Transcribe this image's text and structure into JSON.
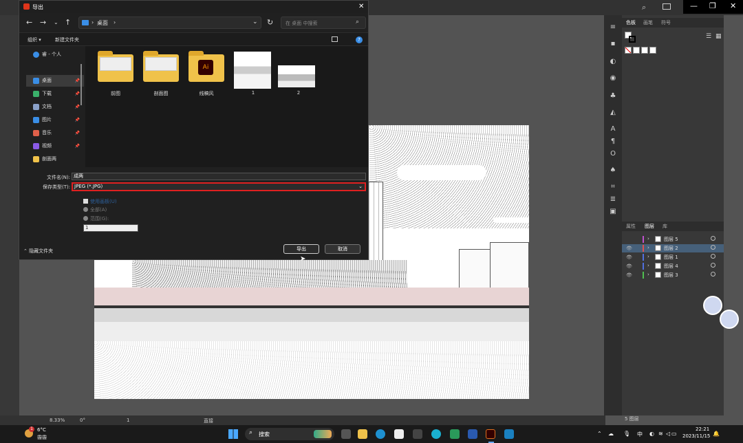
{
  "dialog": {
    "title": "导出",
    "close": "✕",
    "address": {
      "crumb": "桌面",
      "sep": "›"
    },
    "search_placeholder": "在 桌面 中搜索",
    "toolbar": {
      "organize": "组织 ▾",
      "new_folder": "新建文件夹"
    },
    "sidebar": [
      {
        "label": "睿 - 个人",
        "icon": "cloud-icon",
        "color": "#3a8ee6"
      },
      {
        "label": "桌面",
        "icon": "desktop-icon",
        "color": "#3a8ee6",
        "pinned": true
      },
      {
        "label": "下载",
        "icon": "download-icon",
        "color": "#3ab06a",
        "pinned": true
      },
      {
        "label": "文档",
        "icon": "document-icon",
        "color": "#8aa0c8",
        "pinned": true
      },
      {
        "label": "图片",
        "icon": "picture-icon",
        "color": "#3a8ee6",
        "pinned": true
      },
      {
        "label": "音乐",
        "icon": "music-icon",
        "color": "#e0604a",
        "pinned": true
      },
      {
        "label": "视频",
        "icon": "video-icon",
        "color": "#8a5ae6",
        "pinned": true
      },
      {
        "label": "剖面两",
        "icon": "folder-icon",
        "color": "#f0c24a"
      }
    ],
    "files": [
      {
        "name": "前图",
        "type": "folder"
      },
      {
        "name": "剖面图",
        "type": "folder"
      },
      {
        "name": "线稿风",
        "type": "folder-ai"
      },
      {
        "name": "1",
        "type": "image"
      },
      {
        "name": "2",
        "type": "image"
      }
    ],
    "filename_label": "文件名(N):",
    "filename_value": "成两",
    "filetype_label": "保存类型(T):",
    "filetype_value": "JPEG (*.JPG)",
    "opt_artboard": "使用画板(U)",
    "opt_all": "全部(A)",
    "opt_range": "范围(G):",
    "range_value": "1",
    "hide_folders": "隐藏文件夹",
    "export_button": "导出",
    "cancel_button": "取消"
  },
  "panels": {
    "swatch_tabs": [
      "色板",
      "画笔",
      "符号"
    ],
    "layer_tabs": [
      "属性",
      "图层",
      "库"
    ],
    "layers": [
      {
        "name": "图层 5",
        "color": "#c050d0",
        "visible": false,
        "selected": false
      },
      {
        "name": "图层 2",
        "color": "#e05050",
        "visible": true,
        "selected": true
      },
      {
        "name": "图层 1",
        "color": "#5070e0",
        "visible": true,
        "selected": false
      },
      {
        "name": "图层 4",
        "color": "#5070e0",
        "visible": true,
        "selected": false
      },
      {
        "name": "图层 3",
        "color": "#50c050",
        "visible": true,
        "selected": false
      }
    ],
    "layer_count": "5 图层"
  },
  "status": {
    "zoom": "8.33%",
    "rotate": "0°",
    "artboard": "1",
    "tool": "直接"
  },
  "taskbar": {
    "weather_temp": "6°C",
    "weather_desc": "霾霾",
    "search": "搜索",
    "ime": "中",
    "time": "22:21",
    "date": "2023/11/15"
  }
}
